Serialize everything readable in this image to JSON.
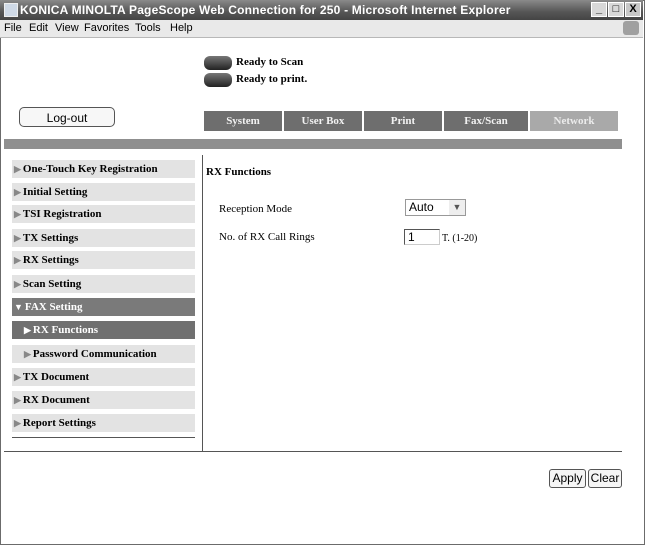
{
  "window": {
    "title": "KONICA MINOLTA PageScope Web Connection for 250 - Microsoft Internet Explorer",
    "minimize": "_",
    "maximize": "□",
    "close": "X"
  },
  "menu": [
    "File",
    "Edit",
    "View",
    "Favorites",
    "Tools",
    "Help"
  ],
  "status": {
    "scan": "Ready to Scan",
    "print": "Ready to print."
  },
  "logout_label": "Log-out",
  "tabs": [
    "System",
    "User Box",
    "Print",
    "Fax/Scan",
    "Network"
  ],
  "sidebar": [
    "One-Touch Key Registration",
    "Initial Setting",
    "TSI Registration",
    "TX Settings",
    "RX Settings",
    "Scan Setting",
    "FAX Setting",
    "RX Functions",
    "Password Communication",
    "TX Document",
    "RX Document",
    "Report Settings"
  ],
  "main": {
    "title": "RX Functions",
    "reception_mode_label": "Reception Mode",
    "reception_mode_value": "Auto",
    "rings_label": "No. of RX Call Rings",
    "rings_value": "1",
    "rings_range": "T. (1-20)"
  },
  "buttons": {
    "apply": "Apply",
    "clear": "Clear"
  },
  "icons": {
    "arrow_right": "▶",
    "arrow_down": "▼",
    "dropdown": "▼"
  }
}
